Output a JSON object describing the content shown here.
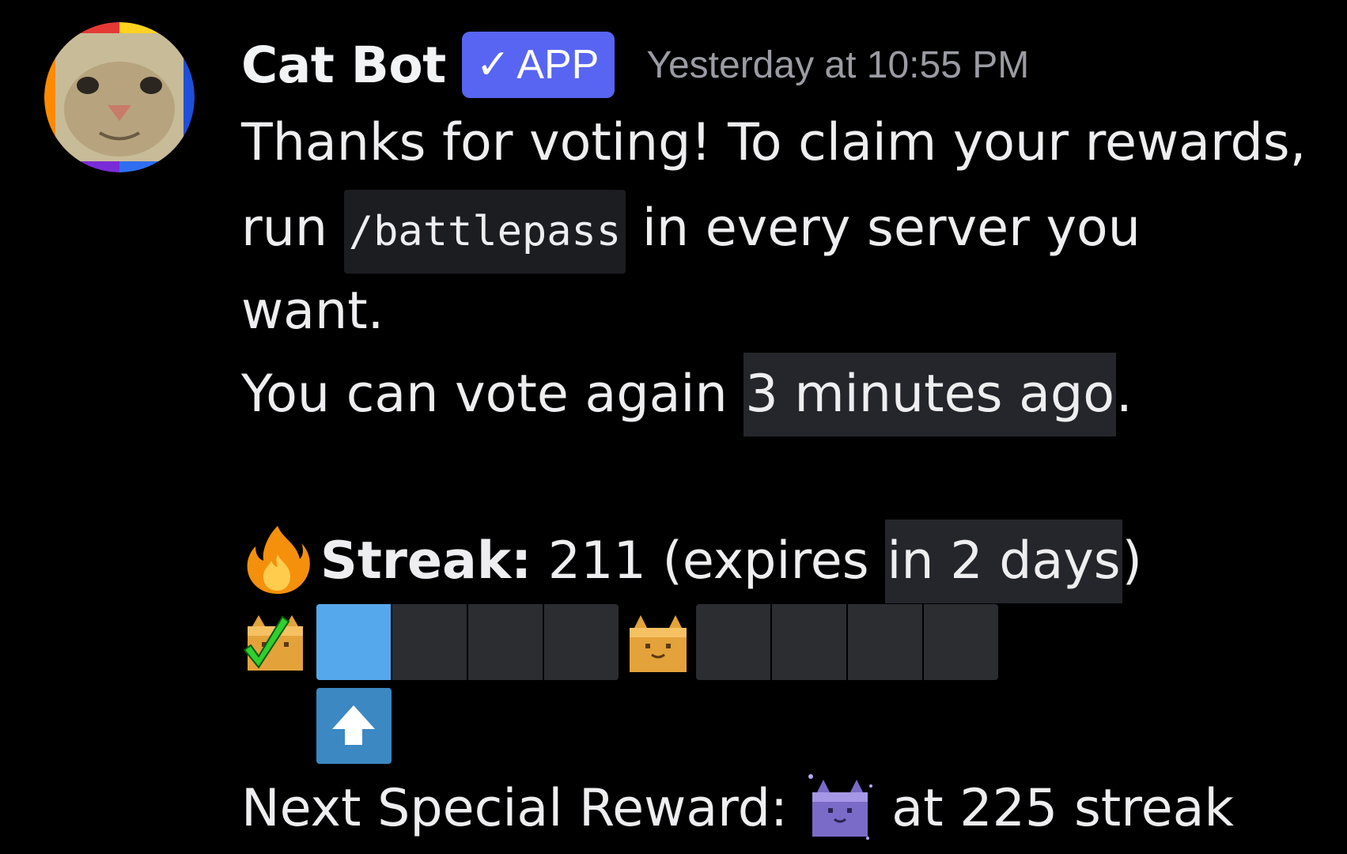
{
  "message": {
    "author": "Cat Bot",
    "badge": {
      "check": "✓",
      "label": "APP",
      "color": "#5865f2"
    },
    "timestamp": "Yesterday at 10:55 PM",
    "text": {
      "line1": "Thanks for voting! To claim your rewards,",
      "line2_prefix": "run ",
      "command": "/battlepass",
      "line2_suffix": " in every server you",
      "line3": "want.",
      "line4_prefix": "You can vote again ",
      "line4_time": "3 minutes ago",
      "line4_suffix": ".",
      "streak_label": "Streak:",
      "streak_value": " 211 (expires ",
      "streak_time": "in 2 days",
      "streak_end": ")",
      "next_prefix": "Next Special Reward: ",
      "next_suffix": " at 225 streak"
    },
    "icons": {
      "avatar": "cat-face-avatar",
      "streak": "fire-icon",
      "claimed_box": "cat-box-checked-icon",
      "mid_box": "cat-box-icon",
      "special_box": "purple-cat-box-icon",
      "progress_marker": "up-arrow-icon"
    },
    "progress": {
      "filled_segments": 1,
      "total_segments": 8
    },
    "colors": {
      "background": "#000000",
      "filled": "#56a8ec",
      "empty": "#2b2d31",
      "marker": "#3b88c3",
      "timestamp_chip": "#25262b"
    }
  }
}
